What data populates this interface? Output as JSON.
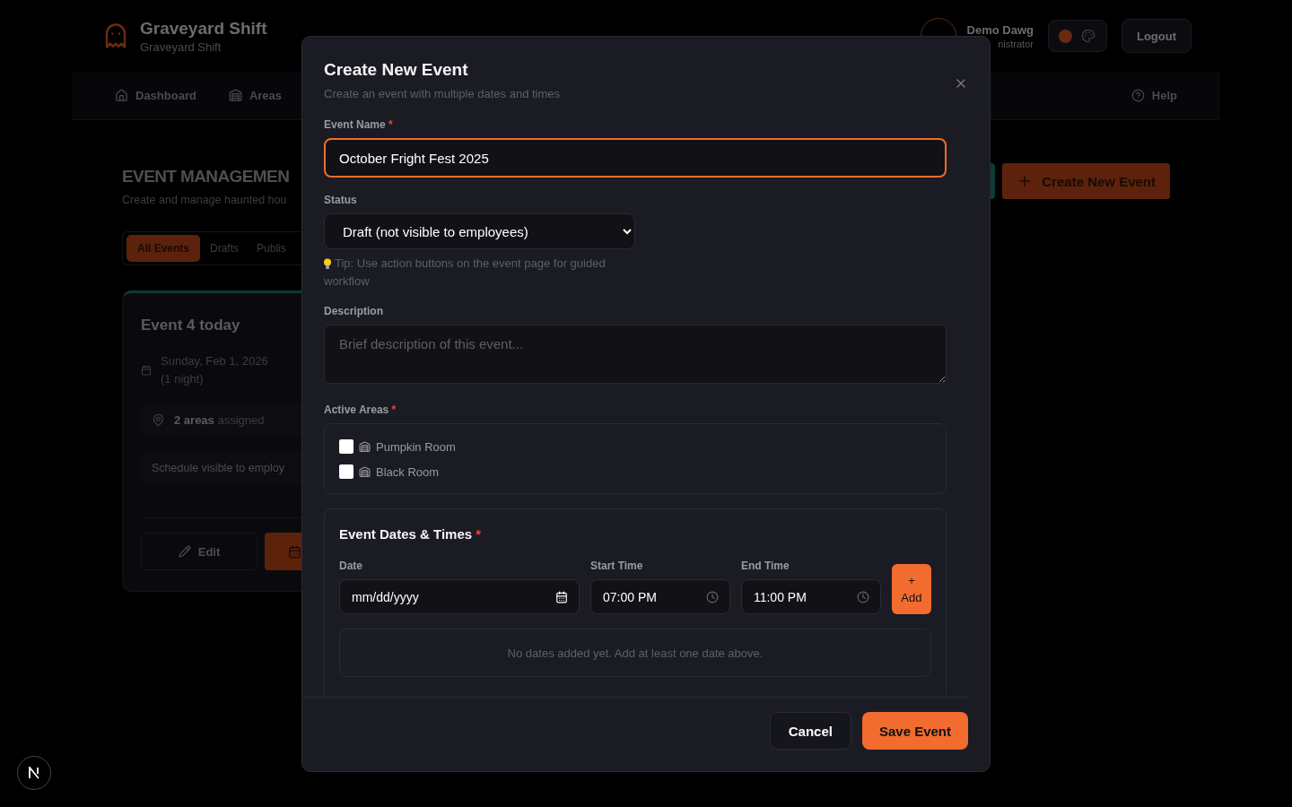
{
  "header": {
    "app_title": "Graveyard Shift",
    "app_subtitle": "Graveyard Shift",
    "user_name": "Demo Dawg",
    "user_role": "nistrator",
    "logout": "Logout"
  },
  "nav": [
    {
      "label": "Dashboard"
    },
    {
      "label": "Areas"
    }
  ],
  "help": "Help",
  "page": {
    "title": "EVENT MANAGEMEN",
    "subtitle": "Create and manage haunted hou",
    "create_button": "Create New Event"
  },
  "filter_tabs": [
    {
      "label": "All Events",
      "selected": true
    },
    {
      "label": "Drafts",
      "selected": false
    },
    {
      "label": "Publis",
      "selected": false
    }
  ],
  "event_card": {
    "title": "Event 4 today",
    "date": "Sunday, Feb 1, 2026",
    "nights": "(1 night)",
    "areas": "**2 areas** assigned",
    "schedule_note": "Schedule visible to employ",
    "edit": "Edit"
  },
  "modal": {
    "required_mark": "*",
    "title": "Create New Event",
    "subtitle": "Create an event with multiple dates and times",
    "name_label": "Event Name",
    "name_value": "October Fright Fest 2025",
    "status_label": "Status",
    "status_value": "Draft (not visible to employees)",
    "tip": "Tip: Use action buttons on the event page for guided workflow",
    "description_label": "Description",
    "description_placeholder": "Brief description of this event...",
    "areas_label": "Active Areas",
    "areas": [
      {
        "label": "Pumpkin Room",
        "checked": false
      },
      {
        "label": "Black Room",
        "checked": false
      }
    ],
    "dates_title": "Event Dates & Times",
    "date_label": "Date",
    "date_value": "mm/dd/yyyy",
    "start_label": "Start Time",
    "start_value": "07:00 PM",
    "end_label": "End Time",
    "end_value": "11:00 PM",
    "add_plus": "+",
    "add_label": "Add",
    "empty_note": "No dates added yet. Add at least one date above.",
    "cancel": "Cancel",
    "save": "Save Event"
  }
}
